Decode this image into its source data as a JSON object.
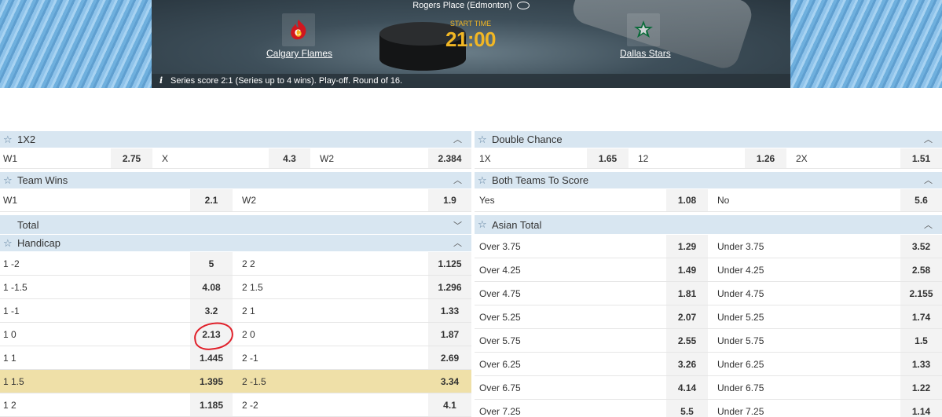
{
  "header": {
    "venue": "Rogers Place (Edmonton)",
    "home_team": "Calgary Flames",
    "away_team": "Dallas Stars",
    "start_label": "START TIME",
    "start_time": "21:00",
    "series_info": "Series score 2:1 (Series up to 4 wins). Play-off. Round of 16.",
    "colors": {
      "accent_time": "#f2b724",
      "home_logo": "#d2161e",
      "away_logo": "#0b6b3a"
    }
  },
  "markets": {
    "m1x2": {
      "title": "1X2",
      "cells": [
        {
          "label": "W1",
          "odd": "2.75"
        },
        {
          "label": "X",
          "odd": "4.3"
        },
        {
          "label": "W2",
          "odd": "2.384"
        }
      ]
    },
    "double_chance": {
      "title": "Double Chance",
      "cells": [
        {
          "label": "1X",
          "odd": "1.65"
        },
        {
          "label": "12",
          "odd": "1.26"
        },
        {
          "label": "2X",
          "odd": "1.51"
        }
      ]
    },
    "team_wins": {
      "title": "Team Wins",
      "cells": [
        {
          "label": "W1",
          "odd": "2.1"
        },
        {
          "label": "W2",
          "odd": "1.9"
        }
      ]
    },
    "btts": {
      "title": "Both Teams To Score",
      "cells": [
        {
          "label": "Yes",
          "odd": "1.08"
        },
        {
          "label": "No",
          "odd": "5.6"
        }
      ]
    },
    "total": {
      "title": "Total"
    },
    "handicap": {
      "title": "Handicap",
      "rows": [
        {
          "l1": "1 -2",
          "o1": "5",
          "l2": "2 2",
          "o2": "1.125"
        },
        {
          "l1": "1 -1.5",
          "o1": "4.08",
          "l2": "2 1.5",
          "o2": "1.296"
        },
        {
          "l1": "1 -1",
          "o1": "3.2",
          "l2": "2 1",
          "o2": "1.33"
        },
        {
          "l1": "1 0",
          "o1": "2.13",
          "l2": "2 0",
          "o2": "1.87"
        },
        {
          "l1": "1 1",
          "o1": "1.445",
          "l2": "2 -1",
          "o2": "2.69"
        },
        {
          "l1": "1 1.5",
          "o1": "1.395",
          "l2": "2 -1.5",
          "o2": "3.34"
        },
        {
          "l1": "1 2",
          "o1": "1.185",
          "l2": "2 -2",
          "o2": "4.1"
        }
      ]
    },
    "asian_total": {
      "title": "Asian Total",
      "rows": [
        {
          "l1": "Over 3.75",
          "o1": "1.29",
          "l2": "Under 3.75",
          "o2": "3.52"
        },
        {
          "l1": "Over 4.25",
          "o1": "1.49",
          "l2": "Under 4.25",
          "o2": "2.58"
        },
        {
          "l1": "Over 4.75",
          "o1": "1.81",
          "l2": "Under 4.75",
          "o2": "2.155"
        },
        {
          "l1": "Over 5.25",
          "o1": "2.07",
          "l2": "Under 5.25",
          "o2": "1.74"
        },
        {
          "l1": "Over 5.75",
          "o1": "2.55",
          "l2": "Under 5.75",
          "o2": "1.5"
        },
        {
          "l1": "Over 6.25",
          "o1": "3.26",
          "l2": "Under 6.25",
          "o2": "1.33"
        },
        {
          "l1": "Over 6.75",
          "o1": "4.14",
          "l2": "Under 6.75",
          "o2": "1.22"
        },
        {
          "l1": "Over 7.25",
          "o1": "5.5",
          "l2": "Under 7.25",
          "o2": "1.14"
        }
      ]
    }
  },
  "icons": {
    "star": "star-icon",
    "collapse": "chevron-up-icon",
    "expand": "chevron-down-icon",
    "info": "info-icon",
    "stadium": "stadium-icon"
  }
}
